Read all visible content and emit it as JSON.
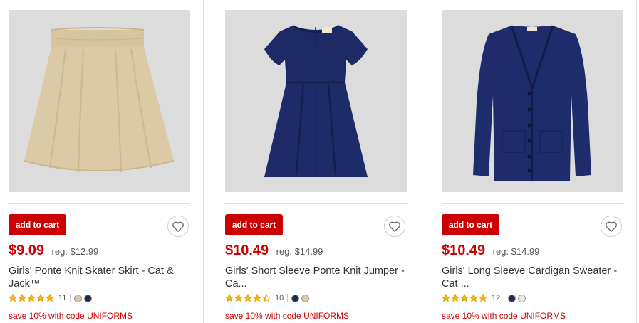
{
  "products": [
    {
      "add_label": "add to cart",
      "price": "$9.09",
      "reg": "reg: $12.99",
      "title": "Girls' Ponte Knit Skater Skirt - Cat & Jack™",
      "rating": 5,
      "review_count": "11",
      "swatches": [
        "#d9c9a4",
        "#1d2a5c"
      ],
      "promo": "save 10% with code UNIFORMS",
      "image_icon": "skirt-image"
    },
    {
      "add_label": "add to cart",
      "price": "$10.49",
      "reg": "reg: $14.99",
      "title": "Girls' Short Sleeve Ponte Knit Jumper - Ca...",
      "rating": 4.5,
      "review_count": "10",
      "swatches": [
        "#1d2a5c",
        "#d9c9a4"
      ],
      "promo": "save 10% with code UNIFORMS",
      "image_icon": "jumper-dress-image"
    },
    {
      "add_label": "add to cart",
      "price": "$10.49",
      "reg": "reg: $14.99",
      "title": "Girls' Long Sleeve Cardigan Sweater - Cat ...",
      "rating": 5,
      "review_count": "12",
      "swatches": [
        "#1d2a5c",
        "#e6e6e6"
      ],
      "promo": "save 10% with code UNIFORMS",
      "image_icon": "cardigan-image"
    }
  ],
  "colors": {
    "brand_red": "#cc0000",
    "star": "#f4b400",
    "image_bg": "#dcdcdc"
  }
}
